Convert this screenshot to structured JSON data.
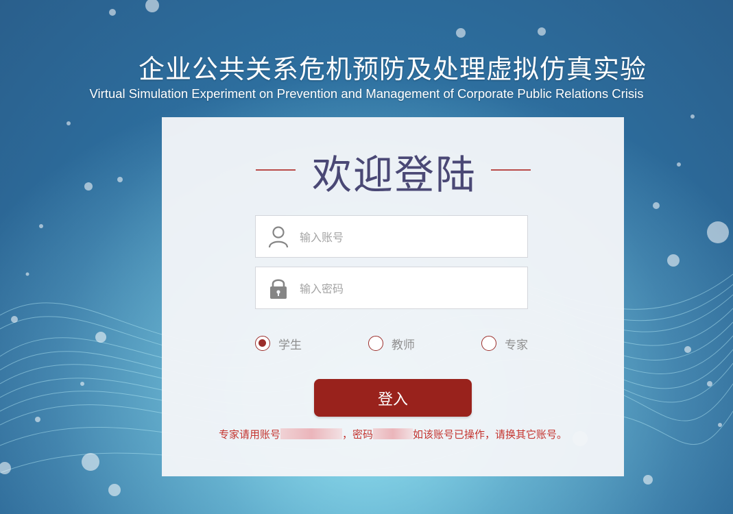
{
  "header": {
    "title_cn": "企业公共关系危机预防及处理虚拟仿真实验",
    "title_en": "Virtual Simulation Experiment on Prevention and Management of Corporate Public Relations Crisis"
  },
  "login": {
    "welcome": "欢迎登陆",
    "account_placeholder": "输入账号",
    "password_placeholder": "输入密码",
    "roles": [
      {
        "label": "学生",
        "checked": true
      },
      {
        "label": "教师",
        "checked": false
      },
      {
        "label": "专家",
        "checked": false
      }
    ],
    "submit_label": "登入",
    "notice": {
      "prefix": "专家请用账号",
      "mid": "，密码",
      "suffix": "如该账号已操作，请换其它账号。"
    }
  },
  "colors": {
    "accent": "#99221c",
    "welcome_text": "#4a4875",
    "notice_text": "#c4332e"
  },
  "icons": [
    "user-icon",
    "lock-icon"
  ]
}
